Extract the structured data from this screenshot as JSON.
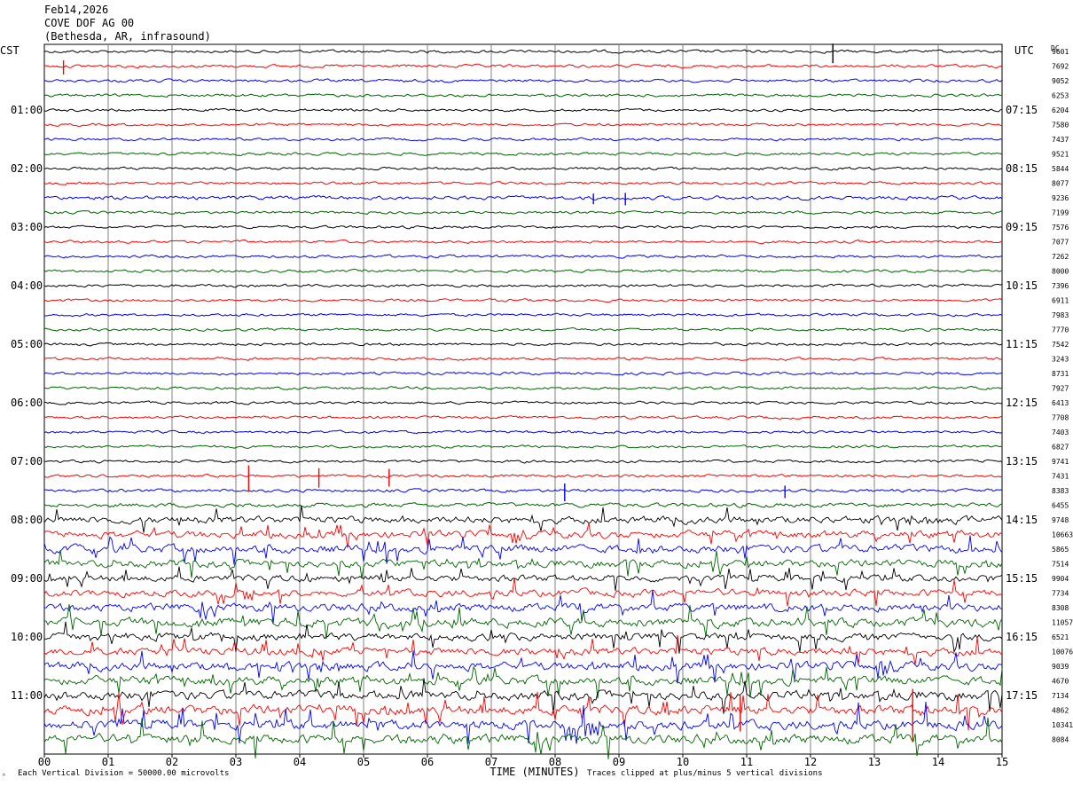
{
  "header": {
    "date": "Feb14,2026",
    "station": "COVE DOF AG 00",
    "location": "(Bethesda, AR, infrasound)"
  },
  "left_zone_label": "CST",
  "right_zone_label": "UTC",
  "dc_label": "DC",
  "footer": {
    "scale_note": "Each Vertical Division = 50000.00 microvolts",
    "clip_note": "Traces clipped at plus/minus 5 vertical divisions",
    "corner_mark": "ᴬ"
  },
  "colors": {
    "cycle": [
      "#000000",
      "#ff0000",
      "#0000ff",
      "#006400"
    ],
    "grid": "#808080"
  },
  "chart_data": {
    "type": "line",
    "title": "",
    "xlabel": "TIME (MINUTES)",
    "xlim": [
      0,
      15
    ],
    "x_ticks": [
      "00",
      "01",
      "02",
      "03",
      "04",
      "05",
      "06",
      "07",
      "08",
      "09",
      "10",
      "11",
      "12",
      "13",
      "14",
      "15"
    ],
    "trace_minutes": 15,
    "left_times": [
      "01:00",
      "02:00",
      "03:00",
      "04:00",
      "05:00",
      "06:00",
      "07:00",
      "08:00",
      "09:00",
      "10:00",
      "11:00"
    ],
    "right_times": [
      "07:15",
      "08:15",
      "09:15",
      "10:15",
      "11:15",
      "12:15",
      "13:15",
      "14:15",
      "15:15",
      "16:15",
      "17:15"
    ],
    "time_label_every_n_traces": 4,
    "dc_offsets": [
      "9601",
      "7692",
      "9052",
      "6253",
      "6204",
      "7580",
      "7437",
      "9521",
      "5844",
      "8077",
      "9236",
      "7199",
      "7576",
      "7077",
      "7262",
      "8000",
      "7396",
      "6911",
      "7983",
      "7770",
      "7542",
      "3243",
      "8731",
      "7927",
      "6413",
      "7708",
      "7403",
      "6827",
      "9741",
      "7431",
      "8383",
      "6455",
      "9748",
      "10663",
      "5865",
      "7514",
      "9904",
      "7734",
      "8308",
      "11057",
      "6521",
      "10076",
      "9039",
      "4670",
      "7134",
      "4862",
      "10341",
      "8084"
    ],
    "trace_activity": [
      0.18,
      0.2,
      0.18,
      0.16,
      0.12,
      0.12,
      0.12,
      0.12,
      0.12,
      0.12,
      0.4,
      0.12,
      0.12,
      0.12,
      0.12,
      0.12,
      0.12,
      0.12,
      0.12,
      0.12,
      0.12,
      0.12,
      0.12,
      0.12,
      0.12,
      0.12,
      0.12,
      0.12,
      0.14,
      0.18,
      0.25,
      0.5,
      1.3,
      1.3,
      1.5,
      1.4,
      1.2,
      1.3,
      1.5,
      1.8,
      1.4,
      1.5,
      1.6,
      1.7,
      1.8,
      1.9,
      1.9,
      1.9
    ],
    "spikes_min": [
      {
        "trace": 0,
        "minute": 12.35,
        "amp": 22
      },
      {
        "trace": 1,
        "minute": 0.3,
        "amp": 16
      },
      {
        "trace": 10,
        "minute": 9.1,
        "amp": 14
      },
      {
        "trace": 10,
        "minute": 8.6,
        "amp": 12
      },
      {
        "trace": 29,
        "minute": 3.2,
        "amp": 30
      },
      {
        "trace": 29,
        "minute": 4.3,
        "amp": 22
      },
      {
        "trace": 29,
        "minute": 5.4,
        "amp": 20
      },
      {
        "trace": 30,
        "minute": 8.15,
        "amp": 20
      },
      {
        "trace": 30,
        "minute": 11.6,
        "amp": 14
      },
      {
        "trace": 45,
        "minute": 13.6,
        "amp": 60
      },
      {
        "trace": 45,
        "minute": 10.9,
        "amp": 40
      }
    ]
  }
}
